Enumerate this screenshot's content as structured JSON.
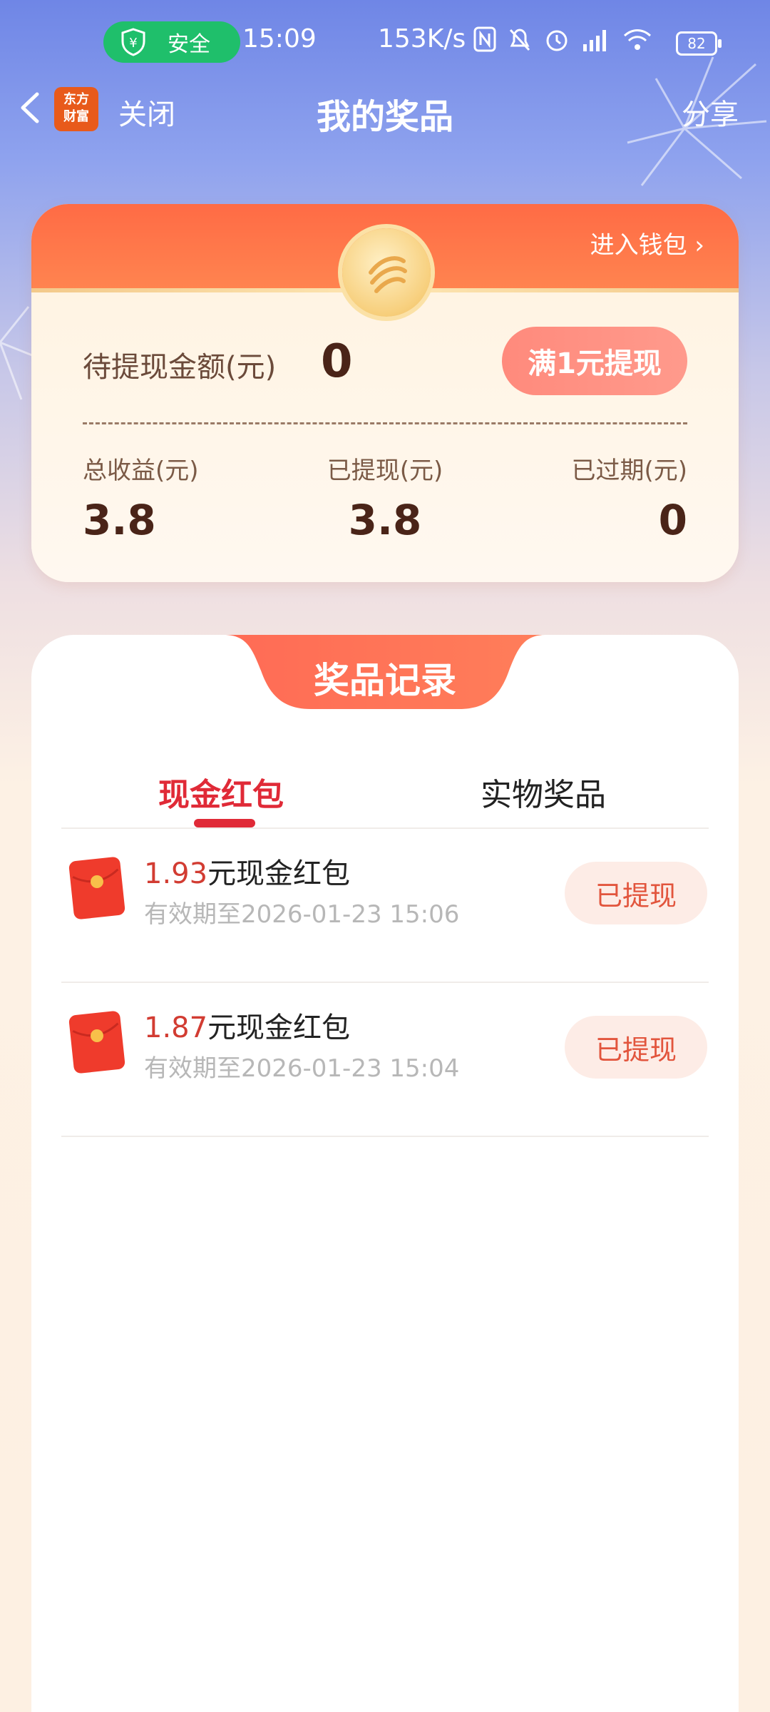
{
  "status_bar": {
    "safe_label": "安全",
    "time": "15:09",
    "net_speed": "153K/s",
    "battery": "82",
    "icons": [
      "shield-yen-icon",
      "nfc-icon",
      "mute-bell-icon",
      "alarm-icon",
      "signal-hd-icon",
      "wifi-icon",
      "battery-icon"
    ]
  },
  "header": {
    "logo_line1": "东方",
    "logo_line2": "财富",
    "close_label": "关闭",
    "title": "我的奖品",
    "share_label": "分享"
  },
  "balance": {
    "wallet_link": "进入钱包",
    "pending_label": "待提现金额(元)",
    "pending_value": "0",
    "withdraw_button": "满1元提现",
    "stats": [
      {
        "label": "总收益(元)",
        "value": "3.8"
      },
      {
        "label": "已提现(元)",
        "value": "3.8"
      },
      {
        "label": "已过期(元)",
        "value": "0"
      }
    ]
  },
  "records": {
    "title": "奖品记录",
    "tabs": [
      {
        "label": "现金红包",
        "active": true
      },
      {
        "label": "实物奖品",
        "active": false
      }
    ],
    "items": [
      {
        "amount": "1.93",
        "suffix": "元现金红包",
        "expiry": "有效期至2026-01-23 15:06",
        "status": "已提现"
      },
      {
        "amount": "1.87",
        "suffix": "元现金红包",
        "expiry": "有效期至2026-01-23 15:04",
        "status": "已提现"
      }
    ]
  },
  "colors": {
    "accent_red": "#e02a37",
    "card_orange": "#ff6b45",
    "safe_green": "#1fbf6b"
  }
}
